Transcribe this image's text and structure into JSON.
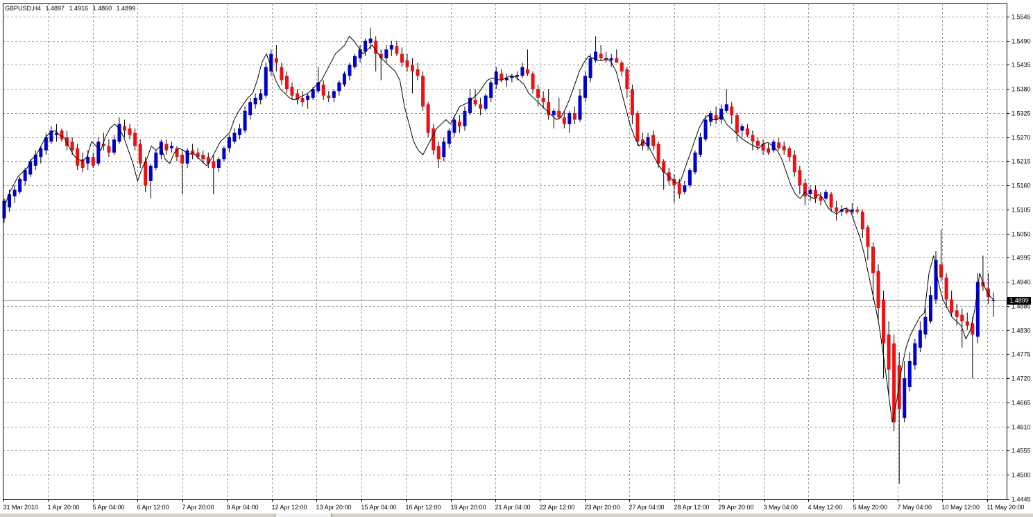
{
  "header": {
    "symbol": "GBPUSD,H4",
    "open": "1.4897",
    "high": "1.4916",
    "low": "1.4860",
    "close": "1.4899"
  },
  "current_price_label": "1.4899",
  "colors": {
    "bull": "#0000cc",
    "bear": "#ee1111",
    "wick": "#000000",
    "line": "#000000",
    "grid": "#9a9a9a",
    "background": "#ffffff",
    "price_line": "#808080"
  },
  "chart_data": {
    "type": "candlestick",
    "symbol": "GBPUSD",
    "timeframe": "H4",
    "ylim": [
      1.4445,
      1.5575
    ],
    "y_ticks": [
      "1.5545",
      "1.5490",
      "1.5435",
      "1.5380",
      "1.5325",
      "1.5270",
      "1.5215",
      "1.5160",
      "1.5105",
      "1.5050",
      "1.4995",
      "1.4940",
      "1.4885",
      "1.4830",
      "1.4775",
      "1.4720",
      "1.4665",
      "1.4610",
      "1.4555",
      "1.4500",
      "1.4445"
    ],
    "x_ticks": [
      "31 Mar 2010",
      "1 Apr 20:00",
      "5 Apr 04:00",
      "6 Apr 12:00",
      "7 Apr 20:00",
      "9 Apr 04:00",
      "12 Apr 12:00",
      "13 Apr 20:00",
      "15 Apr 04:00",
      "16 Apr 12:00",
      "19 Apr 20:00",
      "21 Apr 04:00",
      "22 Apr 12:00",
      "23 Apr 20:00",
      "27 Apr 04:00",
      "28 Apr 12:00",
      "29 Apr 20:00",
      "3 May 04:00",
      "4 May 12:00",
      "5 May 20:00",
      "7 May 04:00",
      "10 May 12:00",
      "11 May 20:00"
    ],
    "grid": true,
    "close_series": [
      1.511,
      1.514,
      1.516,
      1.518,
      1.519,
      1.52,
      1.522,
      1.523,
      1.525,
      1.527,
      1.528,
      1.5285,
      1.5275,
      1.527,
      1.525,
      1.523,
      1.522,
      1.5215,
      1.5225,
      1.526,
      1.525,
      1.524,
      1.527,
      1.529,
      1.53,
      1.529,
      1.527,
      1.524,
      1.521,
      1.517,
      1.52,
      1.522,
      1.525,
      1.524,
      1.525,
      1.522,
      1.521,
      1.5235,
      1.5245,
      1.524,
      1.523,
      1.5235,
      1.5225,
      1.5215,
      1.5205,
      1.522,
      1.524,
      1.526,
      1.527,
      1.528,
      1.531,
      1.533,
      1.5345,
      1.536,
      1.537,
      1.54,
      1.544,
      1.546,
      1.543,
      1.54,
      1.538,
      1.537,
      1.536,
      1.5355,
      1.536,
      1.5365,
      1.537,
      1.538,
      1.539,
      1.54,
      1.542,
      1.544,
      1.546,
      1.547,
      1.548,
      1.55,
      1.549,
      1.5475,
      1.546,
      1.547,
      1.548,
      1.5465,
      1.545,
      1.544,
      1.543,
      1.542,
      1.54,
      1.534,
      1.53,
      1.526,
      1.524,
      1.523,
      1.525,
      1.527,
      1.529,
      1.53,
      1.531,
      1.53,
      1.532,
      1.534,
      1.5345,
      1.535,
      1.536,
      1.537,
      1.5385,
      1.54,
      1.5405,
      1.5402,
      1.54,
      1.5405,
      1.541,
      1.5408,
      1.54,
      1.539,
      1.537,
      1.536,
      1.535,
      1.534,
      1.533,
      1.532,
      1.531,
      1.5315,
      1.5335,
      1.536,
      1.539,
      1.542,
      1.544,
      1.5455,
      1.545,
      1.5445,
      1.5445,
      1.545,
      1.544,
      1.542,
      1.538,
      1.534,
      1.53,
      1.527,
      1.525,
      1.526,
      1.525,
      1.523,
      1.521,
      1.5195,
      1.5185,
      1.5175,
      1.5165,
      1.517,
      1.52,
      1.523,
      1.526,
      1.529,
      1.531,
      1.532,
      1.531,
      1.531,
      1.532,
      1.53,
      1.529,
      1.528,
      1.527,
      1.5262,
      1.5255,
      1.525,
      1.5245,
      1.5255,
      1.5258,
      1.525,
      1.524,
      1.522,
      1.519,
      1.516,
      1.514,
      1.513,
      1.5145,
      1.5135,
      1.513,
      1.514,
      1.513,
      1.511,
      1.51,
      1.5095,
      1.5105,
      1.5108,
      1.51,
      1.507,
      1.504,
      1.5,
      1.495,
      1.49,
      1.485,
      1.478,
      1.47,
      1.462,
      1.467,
      1.474,
      1.479,
      1.482,
      1.484,
      1.486,
      1.487,
      1.496,
      1.5,
      1.494,
      1.49,
      1.488,
      1.486,
      1.485,
      1.484,
      1.481,
      1.483,
      1.488,
      1.496,
      1.493,
      1.491,
      1.4899
    ],
    "candles": [
      [
        1.5085,
        1.513,
        1.5075,
        1.5125
      ],
      [
        1.511,
        1.515,
        1.51,
        1.514
      ],
      [
        1.5135,
        1.516,
        1.512,
        1.515
      ],
      [
        1.5145,
        1.518,
        1.514,
        1.5175
      ],
      [
        1.517,
        1.52,
        1.516,
        1.5195
      ],
      [
        1.5185,
        1.522,
        1.518,
        1.5215
      ],
      [
        1.5205,
        1.524,
        1.5195,
        1.523
      ],
      [
        1.5225,
        1.525,
        1.521,
        1.5245
      ],
      [
        1.524,
        1.528,
        1.523,
        1.527
      ],
      [
        1.526,
        1.5295,
        1.5255,
        1.5285
      ],
      [
        1.5275,
        1.53,
        1.526,
        1.528
      ],
      [
        1.5285,
        1.529,
        1.526,
        1.5265
      ],
      [
        1.527,
        1.5285,
        1.524,
        1.525
      ],
      [
        1.526,
        1.527,
        1.523,
        1.524
      ],
      [
        1.5245,
        1.5255,
        1.5195,
        1.5205
      ],
      [
        1.522,
        1.5235,
        1.519,
        1.52
      ],
      [
        1.521,
        1.524,
        1.5195,
        1.5225
      ],
      [
        1.5225,
        1.5235,
        1.52,
        1.5205
      ],
      [
        1.521,
        1.527,
        1.5205,
        1.526
      ],
      [
        1.5255,
        1.528,
        1.524,
        1.525
      ],
      [
        1.525,
        1.5265,
        1.5225,
        1.5235
      ],
      [
        1.5235,
        1.5275,
        1.523,
        1.5265
      ],
      [
        1.526,
        1.5315,
        1.5255,
        1.53
      ],
      [
        1.5295,
        1.531,
        1.527,
        1.5285
      ],
      [
        1.529,
        1.53,
        1.5265,
        1.5275
      ],
      [
        1.528,
        1.529,
        1.524,
        1.525
      ],
      [
        1.5255,
        1.5265,
        1.52,
        1.521
      ],
      [
        1.5215,
        1.5225,
        1.5145,
        1.516
      ],
      [
        1.517,
        1.521,
        1.513,
        1.5205
      ],
      [
        1.52,
        1.524,
        1.5195,
        1.5235
      ],
      [
        1.523,
        1.5265,
        1.522,
        1.526
      ],
      [
        1.5255,
        1.5265,
        1.523,
        1.524
      ],
      [
        1.5245,
        1.526,
        1.5235,
        1.525
      ],
      [
        1.5245,
        1.525,
        1.5215,
        1.5225
      ],
      [
        1.523,
        1.524,
        1.514,
        1.521
      ],
      [
        1.521,
        1.5245,
        1.52,
        1.524
      ],
      [
        1.524,
        1.5255,
        1.522,
        1.523
      ],
      [
        1.5235,
        1.5245,
        1.522,
        1.5225
      ],
      [
        1.523,
        1.524,
        1.521,
        1.522
      ],
      [
        1.5225,
        1.5235,
        1.52,
        1.521
      ],
      [
        1.5215,
        1.523,
        1.514,
        1.52
      ],
      [
        1.52,
        1.5225,
        1.519,
        1.522
      ],
      [
        1.522,
        1.525,
        1.5215,
        1.5245
      ],
      [
        1.5245,
        1.5275,
        1.5235,
        1.527
      ],
      [
        1.526,
        1.529,
        1.5255,
        1.528
      ],
      [
        1.5275,
        1.53,
        1.5265,
        1.529
      ],
      [
        1.5285,
        1.534,
        1.528,
        1.533
      ],
      [
        1.532,
        1.536,
        1.531,
        1.535
      ],
      [
        1.5345,
        1.537,
        1.5335,
        1.536
      ],
      [
        1.5355,
        1.538,
        1.5345,
        1.537
      ],
      [
        1.5365,
        1.544,
        1.536,
        1.543
      ],
      [
        1.542,
        1.547,
        1.541,
        1.546
      ],
      [
        1.545,
        1.548,
        1.542,
        1.544
      ],
      [
        1.543,
        1.544,
        1.539,
        1.54
      ],
      [
        1.541,
        1.542,
        1.537,
        1.538
      ],
      [
        1.5385,
        1.5395,
        1.5355,
        1.5365
      ],
      [
        1.537,
        1.538,
        1.5345,
        1.5355
      ],
      [
        1.536,
        1.5375,
        1.534,
        1.535
      ],
      [
        1.5355,
        1.537,
        1.5335,
        1.5365
      ],
      [
        1.536,
        1.5385,
        1.5355,
        1.538
      ],
      [
        1.5375,
        1.543,
        1.537,
        1.5395
      ],
      [
        1.539,
        1.54,
        1.5355,
        1.5365
      ],
      [
        1.5365,
        1.5375,
        1.535,
        1.536
      ],
      [
        1.536,
        1.538,
        1.535,
        1.5375
      ],
      [
        1.5375,
        1.54,
        1.5365,
        1.5395
      ],
      [
        1.539,
        1.542,
        1.5385,
        1.5415
      ],
      [
        1.541,
        1.544,
        1.54,
        1.5435
      ],
      [
        1.543,
        1.546,
        1.5425,
        1.5455
      ],
      [
        1.545,
        1.548,
        1.544,
        1.547
      ],
      [
        1.5465,
        1.5495,
        1.5455,
        1.549
      ],
      [
        1.5485,
        1.552,
        1.547,
        1.5495
      ],
      [
        1.549,
        1.55,
        1.542,
        1.546
      ],
      [
        1.546,
        1.547,
        1.54,
        1.545
      ],
      [
        1.545,
        1.548,
        1.544,
        1.547
      ],
      [
        1.547,
        1.549,
        1.5455,
        1.548
      ],
      [
        1.5478,
        1.549,
        1.5455,
        1.546
      ],
      [
        1.546,
        1.5475,
        1.543,
        1.544
      ],
      [
        1.5445,
        1.546,
        1.542,
        1.543
      ],
      [
        1.5435,
        1.545,
        1.537,
        1.542
      ],
      [
        1.5425,
        1.544,
        1.54,
        1.541
      ],
      [
        1.541,
        1.542,
        1.533,
        1.534
      ],
      [
        1.5345,
        1.535,
        1.527,
        1.528
      ],
      [
        1.529,
        1.53,
        1.523,
        1.524
      ],
      [
        1.525,
        1.526,
        1.52,
        1.522
      ],
      [
        1.5225,
        1.527,
        1.5215,
        1.526
      ],
      [
        1.5255,
        1.529,
        1.5245,
        1.5285
      ],
      [
        1.528,
        1.532,
        1.527,
        1.531
      ],
      [
        1.5305,
        1.532,
        1.528,
        1.5295
      ],
      [
        1.5295,
        1.534,
        1.5285,
        1.533
      ],
      [
        1.5325,
        1.538,
        1.532,
        1.536
      ],
      [
        1.5355,
        1.538,
        1.534,
        1.5345
      ],
      [
        1.5345,
        1.536,
        1.532,
        1.5335
      ],
      [
        1.5335,
        1.537,
        1.533,
        1.5365
      ],
      [
        1.536,
        1.54,
        1.535,
        1.5395
      ],
      [
        1.539,
        1.543,
        1.538,
        1.542
      ],
      [
        1.5415,
        1.5425,
        1.5395,
        1.54
      ],
      [
        1.54,
        1.5415,
        1.5385,
        1.5405
      ],
      [
        1.5405,
        1.5415,
        1.5395,
        1.541
      ],
      [
        1.5408,
        1.542,
        1.54,
        1.5412
      ],
      [
        1.541,
        1.544,
        1.5405,
        1.543
      ],
      [
        1.5425,
        1.547,
        1.541,
        1.5415
      ],
      [
        1.5415,
        1.542,
        1.537,
        1.538
      ],
      [
        1.538,
        1.539,
        1.534,
        1.536
      ],
      [
        1.536,
        1.5375,
        1.5335,
        1.535
      ],
      [
        1.535,
        1.538,
        1.531,
        1.532
      ],
      [
        1.532,
        1.5335,
        1.529,
        1.533
      ],
      [
        1.533,
        1.536,
        1.531,
        1.5315
      ],
      [
        1.5315,
        1.533,
        1.529,
        1.53
      ],
      [
        1.53,
        1.533,
        1.528,
        1.5325
      ],
      [
        1.5325,
        1.534,
        1.53,
        1.531
      ],
      [
        1.531,
        1.538,
        1.5305,
        1.5365
      ],
      [
        1.536,
        1.542,
        1.535,
        1.541
      ],
      [
        1.5405,
        1.546,
        1.5395,
        1.545
      ],
      [
        1.5445,
        1.55,
        1.544,
        1.5465
      ],
      [
        1.546,
        1.548,
        1.5445,
        1.545
      ],
      [
        1.545,
        1.5465,
        1.544,
        1.5445
      ],
      [
        1.5445,
        1.546,
        1.543,
        1.545
      ],
      [
        1.545,
        1.547,
        1.544,
        1.544
      ],
      [
        1.544,
        1.5445,
        1.541,
        1.542
      ],
      [
        1.5425,
        1.543,
        1.536,
        1.538
      ],
      [
        1.538,
        1.539,
        1.53,
        1.532
      ],
      [
        1.5325,
        1.533,
        1.525,
        1.526
      ],
      [
        1.5265,
        1.528,
        1.524,
        1.525
      ],
      [
        1.525,
        1.528,
        1.524,
        1.527
      ],
      [
        1.5275,
        1.5285,
        1.524,
        1.525
      ],
      [
        1.5255,
        1.526,
        1.52,
        1.521
      ],
      [
        1.5215,
        1.522,
        1.515,
        1.519
      ],
      [
        1.519,
        1.52,
        1.516,
        1.517
      ],
      [
        1.5175,
        1.5185,
        1.512,
        1.516
      ],
      [
        1.5165,
        1.5175,
        1.513,
        1.514
      ],
      [
        1.5145,
        1.517,
        1.514,
        1.516
      ],
      [
        1.516,
        1.52,
        1.5155,
        1.5195
      ],
      [
        1.519,
        1.524,
        1.5185,
        1.5235
      ],
      [
        1.523,
        1.528,
        1.5225,
        1.527
      ],
      [
        1.5265,
        1.532,
        1.526,
        1.531
      ],
      [
        1.5305,
        1.533,
        1.5295,
        1.5325
      ],
      [
        1.532,
        1.534,
        1.53,
        1.531
      ],
      [
        1.531,
        1.5345,
        1.53,
        1.5335
      ],
      [
        1.533,
        1.538,
        1.5325,
        1.5345
      ],
      [
        1.534,
        1.535,
        1.53,
        1.532
      ],
      [
        1.532,
        1.5325,
        1.526,
        1.528
      ],
      [
        1.5285,
        1.53,
        1.527,
        1.5295
      ],
      [
        1.529,
        1.53,
        1.527,
        1.5275
      ],
      [
        1.5275,
        1.5285,
        1.524,
        1.526
      ],
      [
        1.5262,
        1.527,
        1.524,
        1.525
      ],
      [
        1.5255,
        1.5265,
        1.523,
        1.524
      ],
      [
        1.5245,
        1.5255,
        1.523,
        1.5235
      ],
      [
        1.524,
        1.5265,
        1.5235,
        1.526
      ],
      [
        1.5258,
        1.5268,
        1.524,
        1.5245
      ],
      [
        1.525,
        1.526,
        1.523,
        1.524
      ],
      [
        1.5245,
        1.525,
        1.5215,
        1.5225
      ],
      [
        1.523,
        1.524,
        1.518,
        1.519
      ],
      [
        1.5195,
        1.5205,
        1.514,
        1.516
      ],
      [
        1.5165,
        1.5175,
        1.5115,
        1.5135
      ],
      [
        1.514,
        1.516,
        1.5125,
        1.515
      ],
      [
        1.515,
        1.516,
        1.512,
        1.513
      ],
      [
        1.5135,
        1.5145,
        1.5115,
        1.5125
      ],
      [
        1.513,
        1.515,
        1.5125,
        1.5145
      ],
      [
        1.514,
        1.5145,
        1.51,
        1.511
      ],
      [
        1.511,
        1.5125,
        1.508,
        1.51
      ],
      [
        1.51,
        1.5115,
        1.509,
        1.5105
      ],
      [
        1.5105,
        1.511,
        1.5095,
        1.5098
      ],
      [
        1.51,
        1.512,
        1.5095,
        1.5105
      ],
      [
        1.5105,
        1.5112,
        1.5095,
        1.51
      ],
      [
        1.51,
        1.5105,
        1.504,
        1.506
      ],
      [
        1.5065,
        1.507,
        1.499,
        1.502
      ],
      [
        1.502,
        1.503,
        1.49,
        1.496
      ],
      [
        1.4965,
        1.498,
        1.485,
        1.488
      ],
      [
        1.49,
        1.492,
        1.472,
        1.48
      ],
      [
        1.482,
        1.485,
        1.468,
        1.474
      ],
      [
        1.48,
        1.482,
        1.46,
        1.462
      ],
      [
        1.475,
        1.478,
        1.448,
        1.465
      ],
      [
        1.463,
        1.476,
        1.462,
        1.472
      ],
      [
        1.47,
        1.478,
        1.469,
        1.476
      ],
      [
        1.475,
        1.481,
        1.474,
        1.48
      ],
      [
        1.479,
        1.485,
        1.478,
        1.483
      ],
      [
        1.482,
        1.488,
        1.481,
        1.486
      ],
      [
        1.485,
        1.493,
        1.4845,
        1.491
      ],
      [
        1.49,
        1.501,
        1.489,
        1.499
      ],
      [
        1.498,
        1.506,
        1.494,
        1.495
      ],
      [
        1.495,
        1.496,
        1.488,
        1.49
      ],
      [
        1.49,
        1.492,
        1.486,
        1.487
      ],
      [
        1.4875,
        1.489,
        1.484,
        1.486
      ],
      [
        1.4865,
        1.488,
        1.479,
        1.485
      ],
      [
        1.485,
        1.487,
        1.483,
        1.484
      ],
      [
        1.4845,
        1.486,
        1.472,
        1.482
      ],
      [
        1.4815,
        1.496,
        1.48,
        1.494
      ],
      [
        1.494,
        1.5,
        1.492,
        1.493
      ],
      [
        1.4925,
        1.496,
        1.489,
        1.4905
      ],
      [
        1.4897,
        1.4916,
        1.486,
        1.4899
      ]
    ]
  }
}
